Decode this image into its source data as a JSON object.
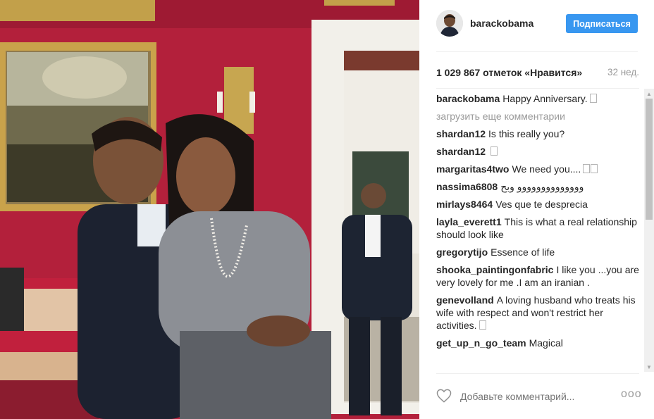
{
  "post": {
    "username": "barackobama",
    "follow_label": "Подписаться",
    "likes": "1 029 867 отметок «Нравится»",
    "age": "32 нед."
  },
  "comments": [
    {
      "author": "barackobama",
      "text": "Happy Anniversary.",
      "emoji": true
    },
    {
      "load_more": "загрузить еще комментарии"
    },
    {
      "author": "shardan12",
      "text": "Is this really you?",
      "emoji": false
    },
    {
      "author": "shardan12",
      "text": "",
      "emoji": true
    },
    {
      "author": "margaritas4two",
      "text": "We need you....",
      "emoji": true,
      "emoji2": true
    },
    {
      "author": "nassima6808",
      "text": "وووووووووووووو وبح",
      "emoji": false
    },
    {
      "author": "mirlays8464",
      "text": "Ves que te desprecia",
      "emoji": false
    },
    {
      "author": "layla_everett1",
      "text": "This is what a real relationship should look like",
      "emoji": false
    },
    {
      "author": "gregorytijo",
      "text": "Essence of life",
      "emoji": false
    },
    {
      "author": "shooka_paintingonfabric",
      "text": "I like you ...you are very lovely for me .I am an iranian .",
      "emoji": false
    },
    {
      "author": "genevolland",
      "text": "A loving husband who treats his wife with respect and won't restrict her activities.",
      "emoji": true
    },
    {
      "author": "get_up_n_go_team",
      "text": "Magical",
      "emoji": false
    }
  ],
  "footer": {
    "comment_placeholder": "Добавьте комментарий...",
    "heart_icon": "heart-outline-icon",
    "more_icon": "more-options-icon",
    "more_glyph": "ooo"
  },
  "colors": {
    "follow_button": "#3897f0",
    "wall": "#b01e3a",
    "muted_text": "#999999"
  }
}
